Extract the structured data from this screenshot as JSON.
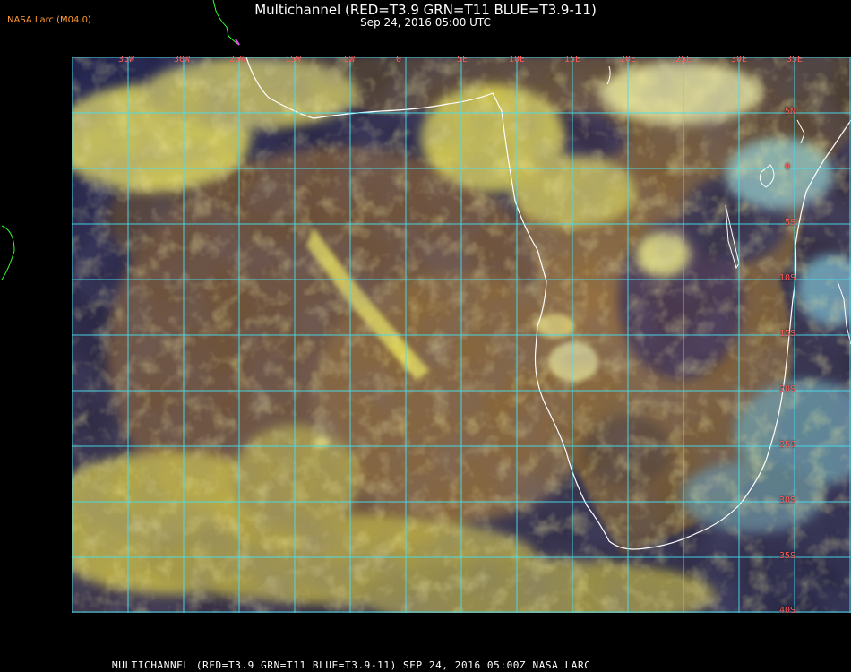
{
  "header": {
    "title": "Multichannel (RED=T3.9 GRN=T11 BLUE=T3.9-11)",
    "subtitle": "Sep 24, 2016 05:00 UTC"
  },
  "badge": "NASA Larc (M04.0)",
  "footer": "MULTICHANNEL (RED=T3.9 GRN=T11 BLUE=T3.9-11) SEP 24, 2016 05:00Z  NASA LARC",
  "grid": {
    "lon_labels": [
      "35W",
      "30W",
      "25W",
      "15W",
      "10W",
      "5W",
      "0",
      "5E",
      "10E",
      "15E",
      "20E",
      "25E",
      "30E",
      "35E"
    ],
    "lat_labels": [
      "5N",
      "0",
      "5S",
      "10S",
      "15S",
      "20S",
      "25S",
      "30S",
      "35S",
      "40S"
    ]
  },
  "colors": {
    "grid": "#46e0f0",
    "coast": "#ffffff",
    "lat_label": "#ff5a5a",
    "ocean": "#1d1f45",
    "land": "#8a6a3c",
    "cloud": "#e8e25a"
  }
}
